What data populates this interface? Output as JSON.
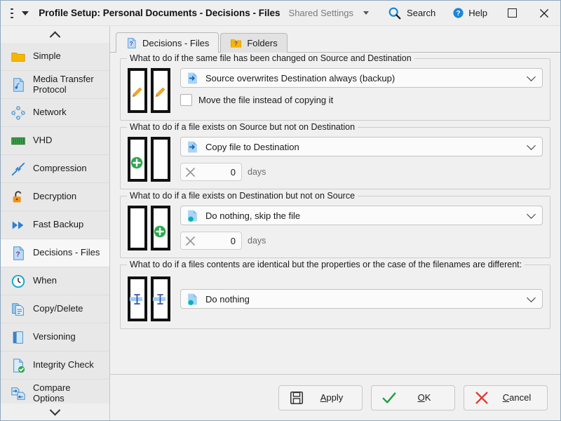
{
  "titlebar": {
    "title": "Profile Setup: Personal Documents - Decisions - Files",
    "menu_icon": "hamburger-icon",
    "dropdown_icon": "caret-down-icon",
    "shared_settings": "Shared Settings",
    "search": "Search",
    "help": "Help",
    "maximize_icon": "maximize-icon",
    "close_icon": "close-icon"
  },
  "sidebar": {
    "scroll_up_icon": "chevron-up-icon",
    "scroll_down_icon": "chevron-down-icon",
    "items": [
      {
        "label": "Simple",
        "icon": "folder-icon",
        "selected": false
      },
      {
        "label": "Media Transfer Protocol",
        "icon": "media-file-icon",
        "selected": false
      },
      {
        "label": "Network",
        "icon": "network-icon",
        "selected": false
      },
      {
        "label": "VHD",
        "icon": "vhd-drive-icon",
        "selected": false
      },
      {
        "label": "Compression",
        "icon": "compression-icon",
        "selected": false
      },
      {
        "label": "Decryption",
        "icon": "unlock-icon",
        "selected": false
      },
      {
        "label": "Fast Backup",
        "icon": "fast-forward-icon",
        "selected": false
      },
      {
        "label": "Decisions - Files",
        "icon": "question-file-icon",
        "selected": true
      },
      {
        "label": "When",
        "icon": "clock-icon",
        "selected": false
      },
      {
        "label": "Copy/Delete",
        "icon": "copy-delete-icon",
        "selected": false
      },
      {
        "label": "Versioning",
        "icon": "versioning-icon",
        "selected": false
      },
      {
        "label": "Integrity Check",
        "icon": "integrity-check-icon",
        "selected": false
      },
      {
        "label": "Compare Options",
        "icon": "compare-options-icon",
        "selected": false
      }
    ]
  },
  "tabs": [
    {
      "label": "Decisions - Files",
      "icon": "question-file-icon",
      "active": true
    },
    {
      "label": "Folders",
      "icon": "question-folder-icon",
      "active": false
    }
  ],
  "groups": [
    {
      "title": "What to do if the same file has been changed on Source and Destination",
      "pane_icon": "pencil-pencil-panes",
      "combo": {
        "value": "Source overwrites Destination always (backup)",
        "icon": "file-arrow-right-icon"
      },
      "checkbox": {
        "label": "Move the file instead of copying it",
        "checked": false
      },
      "spin": null
    },
    {
      "title": "What to do if a file exists on Source but not on Destination",
      "pane_icon": "plus-left-panes",
      "combo": {
        "value": "Copy file to Destination",
        "icon": "file-arrow-right-icon"
      },
      "checkbox": null,
      "spin": {
        "value": "0",
        "unit": "days",
        "icon": "x-mark-icon"
      }
    },
    {
      "title": "What to do if a file exists on Destination but not on Source",
      "pane_icon": "plus-right-panes",
      "combo": {
        "value": "Do nothing, skip the file",
        "icon": "file-dot-icon"
      },
      "checkbox": null,
      "spin": {
        "value": "0",
        "unit": "days",
        "icon": "x-mark-icon"
      }
    },
    {
      "title": "What to do if a files contents are identical but the properties or the case of the filenames are different:",
      "pane_icon": "ibeam-panes",
      "combo": {
        "value": "Do nothing",
        "icon": "file-dot-icon"
      },
      "checkbox": null,
      "spin": null
    }
  ],
  "footer": {
    "apply": {
      "label_before": "",
      "accel": "A",
      "label_after": "pply",
      "icon": "save-disk-icon"
    },
    "ok": {
      "label_before": "",
      "accel": "O",
      "label_after": "K",
      "icon": "check-icon"
    },
    "cancel": {
      "label_before": "",
      "accel": "C",
      "label_after": "ancel",
      "icon": "x-red-icon"
    }
  },
  "colors": {
    "accent_blue": "#2b7fd4",
    "folder_yellow": "#f2b200",
    "green": "#2fa84f",
    "red": "#e03b30",
    "teal": "#00b2b8"
  }
}
